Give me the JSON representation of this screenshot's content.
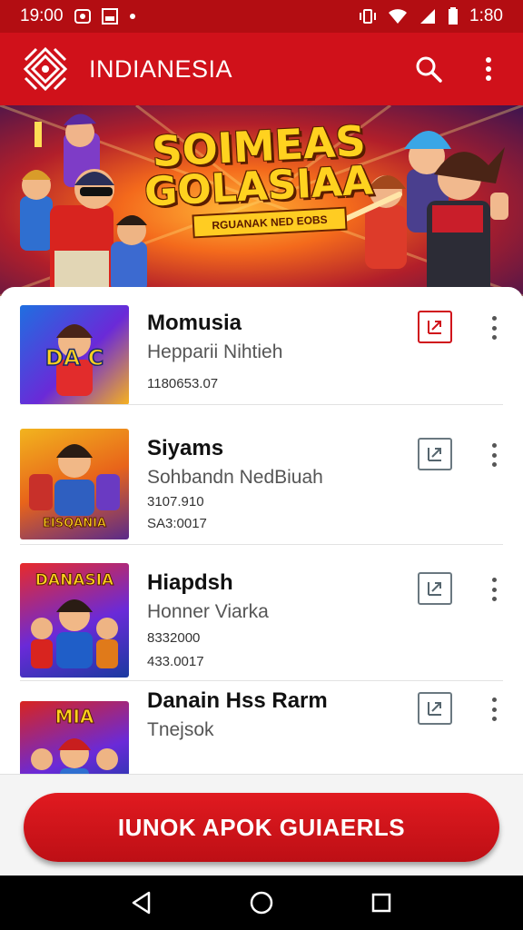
{
  "status_bar": {
    "time": "19:00",
    "clock_right": "1:80"
  },
  "app_bar": {
    "title": "INDIANESIA",
    "icons": [
      "search-icon",
      "more-vert-icon"
    ]
  },
  "banner": {
    "title_line1": "SOIMEAS",
    "title_line2": "GOLASIAA",
    "subtitle": "RGUANAK NED EOBS",
    "slide_count": 3,
    "active_slide": 2
  },
  "games": [
    {
      "title": "Momusia",
      "subtitle": "Hepparii Nihtieh",
      "meta": [
        "1180653.07"
      ],
      "thumb_text": "DA C"
    },
    {
      "title": "Siyams",
      "subtitle": "Sohbandn NedBiuah",
      "meta": [
        "3107.910",
        "SA3:0017"
      ],
      "thumb_text": "EISQANIA"
    },
    {
      "title": "Hiapdsh",
      "subtitle": "Honner Viarka",
      "meta": [
        "8332000",
        "433.0017"
      ],
      "thumb_text": "DANASIA"
    },
    {
      "title": "Danain Hss Rarm",
      "subtitle": "Tnejsok",
      "meta": [],
      "thumb_text": "MIA"
    }
  ],
  "cta": {
    "label": "IUNOK APOK GUIAERLS"
  },
  "colors": {
    "brand_red": "#d0111a",
    "status_red": "#b30d12",
    "banner_gold": "#ffd21f"
  }
}
